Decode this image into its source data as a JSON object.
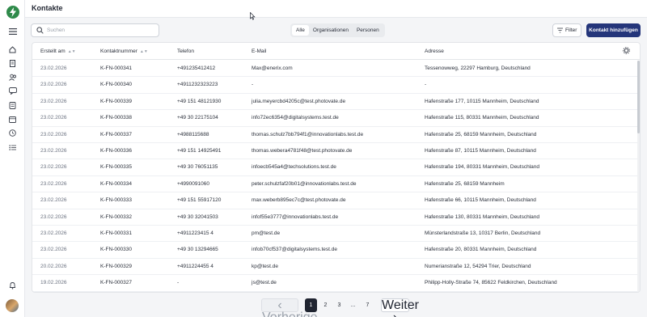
{
  "header": {
    "title": "Kontakte"
  },
  "sidebar": {
    "icons": [
      "home-icon",
      "document-icon",
      "users-icon",
      "chat-icon",
      "receipt-icon",
      "calendar-icon",
      "clock-icon",
      "globe-icon",
      "list-icon"
    ],
    "bottom_icons": [
      "bell-icon"
    ]
  },
  "toolbar": {
    "search_placeholder": "Suchen",
    "segments": [
      "Alle",
      "Organisationen",
      "Personen"
    ],
    "active_segment": "Alle",
    "filter_label": "Filter",
    "add_label": "Kontakt hinzufügen"
  },
  "table": {
    "columns": [
      "Erstellt am",
      "Kontaktnummer",
      "Telefon",
      "E-Mail",
      "Adresse"
    ],
    "rows": [
      [
        "23.02.2026",
        "K-FN-000341",
        "+491235412412",
        "Max@enerix.com",
        "Tessenowweg, 22297 Hamburg, Deutschland"
      ],
      [
        "23.02.2026",
        "K-FN-000340",
        "+4911232323223",
        "-",
        "-"
      ],
      [
        "23.02.2026",
        "K-FN-000339",
        "+49 151 48121930",
        "julia.meyercbd4205c@test.photovate.de",
        "Hafenstraße 177, 10115 Mannheim, Deutschland"
      ],
      [
        "23.02.2026",
        "K-FN-000338",
        "+49 30 22175104",
        "info72ec6354@digitalsystems.test.de",
        "Hafenstraße 115, 80331 Mannheim, Deutschland"
      ],
      [
        "23.02.2026",
        "K-FN-000337",
        "+4988115688",
        "thomas.schulz7bb794f1@innovationlabs.test.de",
        "Hafenstraße 25, 68159 Mannheim, Deutschland"
      ],
      [
        "23.02.2026",
        "K-FN-000336",
        "+49 151 14925491",
        "thomas.webera4781f48@test.photovate.de",
        "Hafenstraße 87, 10115 Mannheim, Deutschland"
      ],
      [
        "23.02.2026",
        "K-FN-000335",
        "+49 30 76051135",
        "infoecb545a4@techsolutions.test.de",
        "Hafenstraße 194, 80331 Mannheim, Deutschland"
      ],
      [
        "23.02.2026",
        "K-FN-000334",
        "+4990091060",
        "peter.schulzfaf20b01@innovationlabs.test.de",
        "Hafenstraße 25, 68159 Mannheim"
      ],
      [
        "23.02.2026",
        "K-FN-000333",
        "+49 151 55917120",
        "max.weberb895ec7c@test.photovate.de",
        "Hafenstraße 66, 10115 Mannheim, Deutschland"
      ],
      [
        "23.02.2026",
        "K-FN-000332",
        "+49 30 32041503",
        "infof55e3777@innovationlabs.test.de",
        "Hafenstraße 130, 80331 Mannheim, Deutschland"
      ],
      [
        "23.02.2026",
        "K-FN-000331",
        "+4911223415 4",
        "pm@test.de",
        "Münsterlandstraße 13, 10317 Berlin, Deutschland"
      ],
      [
        "23.02.2026",
        "K-FN-000330",
        "+49 30 13294665",
        "infob70cf537@digitalsystems.test.de",
        "Hafenstraße 20, 80331 Mannheim, Deutschland"
      ],
      [
        "20.02.2026",
        "K-FN-000329",
        "+4911224455 4",
        "kp@test.de",
        "Numerianstraße 12, 54294 Trier, Deutschland"
      ],
      [
        "19.02.2026",
        "K-FN-000327",
        "-",
        "js@test.de",
        "Philipp-Holly-Straße 74, 85622 Feldkirchen, Deutschland"
      ]
    ]
  },
  "pagination": {
    "prev_label": "Vorherige",
    "next_label": "Weiter",
    "pages": [
      "1",
      "2",
      "3",
      "...",
      "7"
    ],
    "current": "1"
  }
}
